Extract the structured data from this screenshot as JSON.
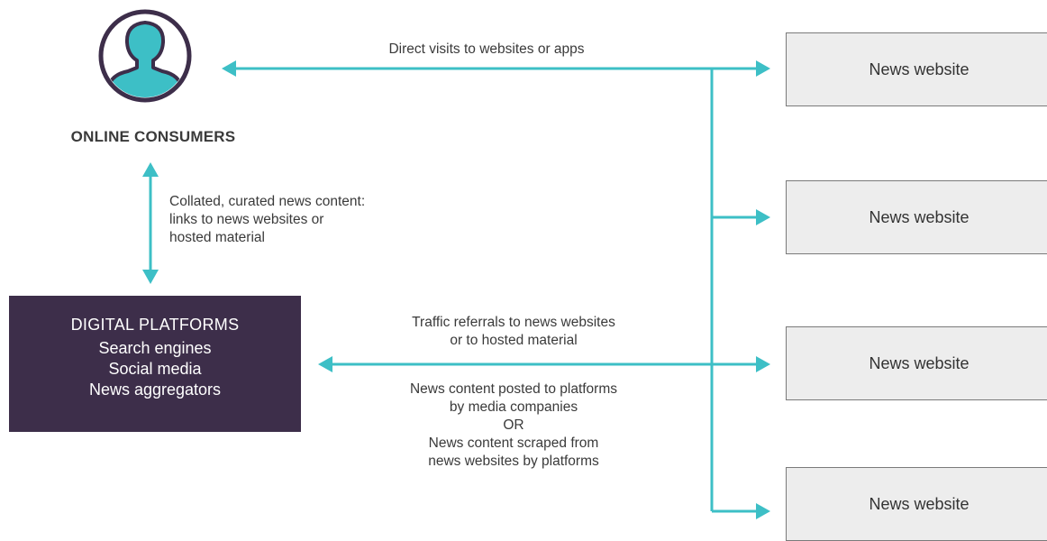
{
  "colors": {
    "arrow": "#3dbfc6",
    "platform_box": "#3d2e4a",
    "news_box_fill": "#ededed",
    "news_box_border": "#7a7a7a",
    "icon_outline": "#3d2e4a",
    "icon_fill": "#3dbfc6"
  },
  "consumers": {
    "icon": "person-icon",
    "label": "ONLINE CONSUMERS"
  },
  "platforms": {
    "title": "DIGITAL PLATFORMS",
    "items": [
      "Search engines",
      "Social media",
      "News aggregators"
    ]
  },
  "news_websites": [
    {
      "label": "News website"
    },
    {
      "label": "News website"
    },
    {
      "label": "News website"
    },
    {
      "label": "News website"
    }
  ],
  "labels": {
    "direct_visits": "Direct visits to websites or apps",
    "curated": [
      "Collated, curated news content:",
      "links to news websites or",
      "hosted material"
    ],
    "referrals": [
      "Traffic referrals to news websites",
      "or to hosted material"
    ],
    "content": [
      "News content posted to platforms",
      "by media companies",
      "OR",
      "News content scraped from",
      "news websites by platforms"
    ]
  }
}
